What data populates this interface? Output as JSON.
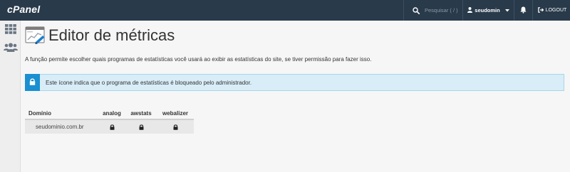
{
  "topbar": {
    "logo": "cPanel",
    "search_placeholder": "Pesquisar ( / )",
    "username": "seudomin",
    "logout_label": "LOGOUT",
    "icons": [
      "search-icon",
      "user-icon",
      "caret-down-icon",
      "bell-icon",
      "logout-icon"
    ]
  },
  "sidebar": {
    "items": [
      {
        "icon": "grid-icon"
      },
      {
        "icon": "users-icon"
      }
    ]
  },
  "main": {
    "title": "Editor de métricas",
    "description": "A função permite escolher quais programas de estatísticas você usará ao exibir as estatísticas do site, se tiver permissão para fazer isso.",
    "alert_text": "Este ícone indica que o programa de estatísticas é bloqueado pelo administrador.",
    "table": {
      "headers": [
        "Domínio",
        "analog",
        "awstats",
        "webalizer"
      ],
      "rows": [
        {
          "domain": "seudominio.com.br",
          "analog": "locked",
          "awstats": "locked",
          "webalizer": "locked"
        }
      ]
    }
  },
  "colors": {
    "topbar_bg": "#293a4a",
    "alert_bg": "#d8edf7",
    "alert_border": "#a6d6ec",
    "alert_icon_bg": "#1a8fd2"
  }
}
